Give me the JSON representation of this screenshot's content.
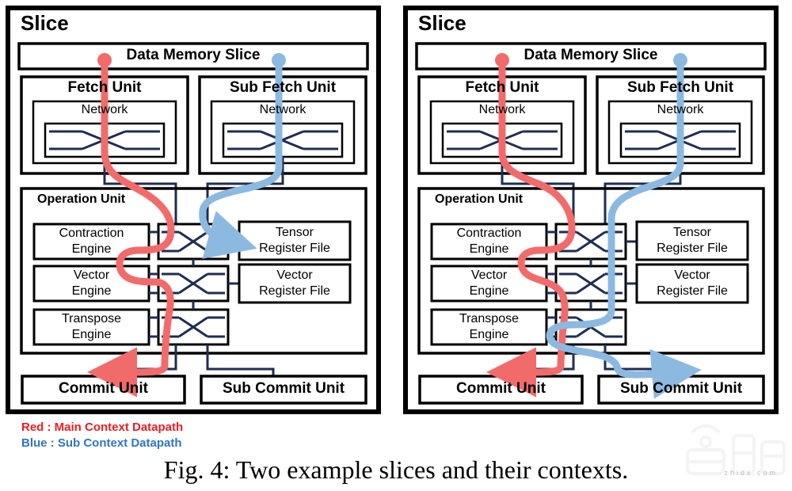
{
  "figure": {
    "caption": "Fig. 4: Two example slices and their contexts.",
    "legend": [
      {
        "key": "red",
        "text": "Red : Main Context Datapath",
        "color": "#ED1C24"
      },
      {
        "key": "blue",
        "text": "Blue : Sub Context Datapath",
        "color": "#2E75C6"
      }
    ],
    "colors": {
      "red_path": "#F26B6B",
      "blue_path": "#8CB9E0",
      "wire": "#1F2D50",
      "box_border": "#000000",
      "background": "#FFFFFF"
    },
    "watermark": {
      "text": "zhidx.com"
    }
  },
  "panels": [
    {
      "id": "left-slice",
      "title": "Slice",
      "data_memory": {
        "label": "Data Memory Slice"
      },
      "fetch_units": [
        {
          "id": "fetch-unit",
          "title": "Fetch Unit",
          "network": {
            "label": "Network",
            "icon": "crossbar-switch-icon"
          }
        },
        {
          "id": "sub-fetch-unit",
          "title": "Sub Fetch Unit",
          "network": {
            "label": "Network",
            "icon": "crossbar-switch-icon"
          }
        }
      ],
      "operation_unit": {
        "title": "Operation Unit",
        "engines": [
          {
            "id": "contraction-engine",
            "label": "Contraction\nEngine"
          },
          {
            "id": "vector-engine",
            "label": "Vector\nEngine"
          },
          {
            "id": "transpose-engine",
            "label": "Transpose\nEngine"
          }
        ],
        "switches": [
          {
            "id": "switch-top",
            "icon": "crossbar-switch-icon"
          },
          {
            "id": "switch-middle",
            "icon": "crossbar-switch-icon"
          },
          {
            "id": "switch-bottom",
            "icon": "crossbar-switch-icon"
          }
        ],
        "register_files": [
          {
            "id": "tensor-register-file",
            "label": "Tensor\nRegister File"
          },
          {
            "id": "vector-register-file",
            "label": "Vector\nRegister File"
          }
        ]
      },
      "commit_units": [
        {
          "id": "commit-unit",
          "label": "Commit Unit"
        },
        {
          "id": "sub-commit-unit",
          "label": "Sub Commit Unit"
        }
      ]
    },
    {
      "id": "right-slice",
      "title": "Slice",
      "data_memory": {
        "label": "Data Memory Slice"
      },
      "fetch_units": [
        {
          "id": "fetch-unit",
          "title": "Fetch Unit",
          "network": {
            "label": "Network",
            "icon": "crossbar-switch-icon"
          }
        },
        {
          "id": "sub-fetch-unit",
          "title": "Sub Fetch Unit",
          "network": {
            "label": "Network",
            "icon": "crossbar-switch-icon"
          }
        }
      ],
      "operation_unit": {
        "title": "Operation Unit",
        "engines": [
          {
            "id": "contraction-engine",
            "label": "Contraction\nEngine"
          },
          {
            "id": "vector-engine",
            "label": "Vector\nEngine"
          },
          {
            "id": "transpose-engine",
            "label": "Transpose\nEngine"
          }
        ],
        "switches": [
          {
            "id": "switch-top",
            "icon": "crossbar-switch-icon"
          },
          {
            "id": "switch-middle",
            "icon": "crossbar-switch-icon"
          },
          {
            "id": "switch-bottom",
            "icon": "crossbar-switch-icon"
          }
        ],
        "register_files": [
          {
            "id": "tensor-register-file",
            "label": "Tensor\nRegister File"
          },
          {
            "id": "vector-register-file",
            "label": "Vector\nRegister File"
          }
        ]
      },
      "commit_units": [
        {
          "id": "commit-unit",
          "label": "Commit Unit"
        },
        {
          "id": "sub-commit-unit",
          "label": "Sub Commit Unit"
        }
      ]
    }
  ]
}
